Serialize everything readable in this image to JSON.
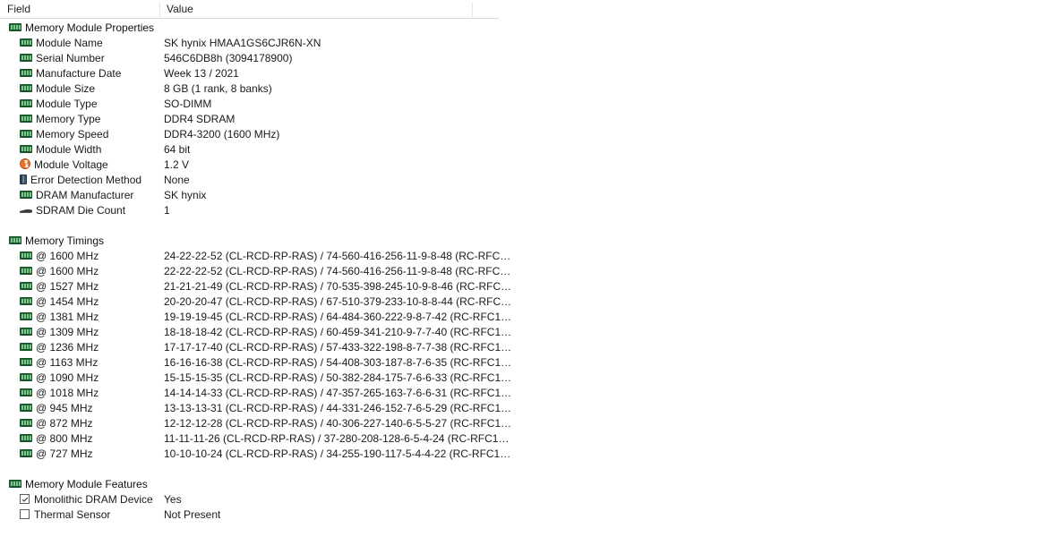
{
  "header": {
    "field_label": "Field",
    "value_label": "Value"
  },
  "sections": [
    {
      "title": "Memory Module Properties",
      "icon": "ram-icon",
      "rows": [
        {
          "field": "Module Name",
          "icon": "ram-icon",
          "value": "SK hynix HMAA1GS6CJR6N-XN"
        },
        {
          "field": "Serial Number",
          "icon": "ram-icon",
          "value": "546C6DB8h (3094178900)"
        },
        {
          "field": "Manufacture Date",
          "icon": "ram-icon",
          "value": "Week 13 / 2021"
        },
        {
          "field": "Module Size",
          "icon": "ram-icon",
          "value": "8 GB (1 rank, 8 banks)"
        },
        {
          "field": "Module Type",
          "icon": "ram-icon",
          "value": "SO-DIMM"
        },
        {
          "field": "Memory Type",
          "icon": "ram-icon",
          "value": "DDR4 SDRAM"
        },
        {
          "field": "Memory Speed",
          "icon": "ram-icon",
          "value": "DDR4-3200 (1600 MHz)"
        },
        {
          "field": "Module Width",
          "icon": "ram-icon",
          "value": "64 bit"
        },
        {
          "field": "Module Voltage",
          "icon": "voltage-icon",
          "value": "1.2 V"
        },
        {
          "field": "Error Detection Method",
          "icon": "chip-icon",
          "value": "None"
        },
        {
          "field": "DRAM Manufacturer",
          "icon": "ram-icon",
          "value": "SK hynix"
        },
        {
          "field": "SDRAM Die Count",
          "icon": "die-icon",
          "value": "1"
        }
      ]
    },
    {
      "title": "Memory Timings",
      "icon": "ram-icon",
      "rows": [
        {
          "field": "@ 1600 MHz",
          "icon": "ram-icon",
          "value": "24-22-22-52  (CL-RCD-RP-RAS) / 74-560-416-256-11-9-8-48  (RC-RFC…"
        },
        {
          "field": "@ 1600 MHz",
          "icon": "ram-icon",
          "value": "22-22-22-52  (CL-RCD-RP-RAS) / 74-560-416-256-11-9-8-48  (RC-RFC…"
        },
        {
          "field": "@ 1527 MHz",
          "icon": "ram-icon",
          "value": "21-21-21-49  (CL-RCD-RP-RAS) / 70-535-398-245-10-9-8-46  (RC-RFC…"
        },
        {
          "field": "@ 1454 MHz",
          "icon": "ram-icon",
          "value": "20-20-20-47  (CL-RCD-RP-RAS) / 67-510-379-233-10-8-8-44  (RC-RFC…"
        },
        {
          "field": "@ 1381 MHz",
          "icon": "ram-icon",
          "value": "19-19-19-45  (CL-RCD-RP-RAS) / 64-484-360-222-9-8-7-42  (RC-RFC1…"
        },
        {
          "field": "@ 1309 MHz",
          "icon": "ram-icon",
          "value": "18-18-18-42  (CL-RCD-RP-RAS) / 60-459-341-210-9-7-7-40  (RC-RFC1…"
        },
        {
          "field": "@ 1236 MHz",
          "icon": "ram-icon",
          "value": "17-17-17-40  (CL-RCD-RP-RAS) / 57-433-322-198-8-7-7-38  (RC-RFC1…"
        },
        {
          "field": "@ 1163 MHz",
          "icon": "ram-icon",
          "value": "16-16-16-38  (CL-RCD-RP-RAS) / 54-408-303-187-8-7-6-35  (RC-RFC1…"
        },
        {
          "field": "@ 1090 MHz",
          "icon": "ram-icon",
          "value": "15-15-15-35  (CL-RCD-RP-RAS) / 50-382-284-175-7-6-6-33  (RC-RFC1…"
        },
        {
          "field": "@ 1018 MHz",
          "icon": "ram-icon",
          "value": "14-14-14-33  (CL-RCD-RP-RAS) / 47-357-265-163-7-6-6-31  (RC-RFC1…"
        },
        {
          "field": "@ 945 MHz",
          "icon": "ram-icon",
          "value": "13-13-13-31  (CL-RCD-RP-RAS) / 44-331-246-152-7-6-5-29  (RC-RFC1…"
        },
        {
          "field": "@ 872 MHz",
          "icon": "ram-icon",
          "value": "12-12-12-28  (CL-RCD-RP-RAS) / 40-306-227-140-6-5-5-27  (RC-RFC1…"
        },
        {
          "field": "@ 800 MHz",
          "icon": "ram-icon",
          "value": "11-11-11-26  (CL-RCD-RP-RAS) / 37-280-208-128-6-5-4-24  (RC-RFC1…"
        },
        {
          "field": "@ 727 MHz",
          "icon": "ram-icon",
          "value": "10-10-10-24  (CL-RCD-RP-RAS) / 34-255-190-117-5-4-4-22  (RC-RFC1…"
        }
      ]
    },
    {
      "title": "Memory Module Features",
      "icon": "ram-icon",
      "rows": [
        {
          "field": "Monolithic DRAM Device",
          "icon": "checkbox-checked-icon",
          "value": "Yes"
        },
        {
          "field": "Thermal Sensor",
          "icon": "checkbox-unchecked-icon",
          "value": "Not Present"
        }
      ]
    }
  ]
}
